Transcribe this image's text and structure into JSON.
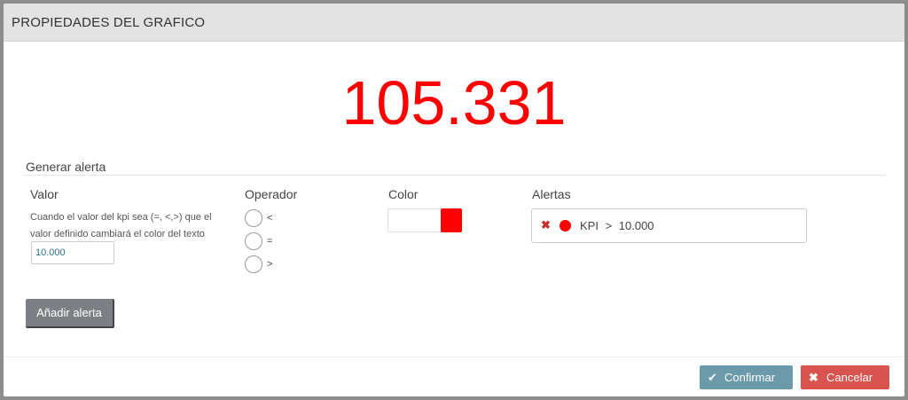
{
  "dialog": {
    "title": "PROPIEDADES DEL GRAFICO"
  },
  "kpi": {
    "value": "105.331",
    "color": "#ff0000"
  },
  "alert_section": {
    "title": "Generar alerta",
    "valor": {
      "label": "Valor",
      "description": "Cuando el valor del kpi sea (=, <,>) que el valor definido cambiará el color del texto",
      "input_value": "10.000"
    },
    "operador": {
      "label": "Operador",
      "options": [
        "<",
        "=",
        ">"
      ]
    },
    "color": {
      "label": "Color",
      "swatch": "#ff0000"
    },
    "alertas": {
      "label": "Alertas",
      "items": [
        {
          "remove_icon": "close-icon",
          "dot_color": "#ff0000",
          "text": "KPI > 10.000"
        }
      ]
    },
    "add_button": "Añadir alerta"
  },
  "footer": {
    "confirm": {
      "icon": "check-icon",
      "label": "Confirmar"
    },
    "cancel": {
      "icon": "close-icon",
      "label": "Cancelar"
    }
  }
}
